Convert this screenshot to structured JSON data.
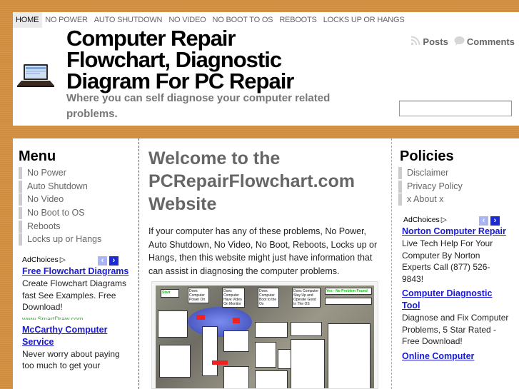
{
  "nav": {
    "items": [
      "HOME",
      "NO POWER",
      "AUTO SHUTDOWN",
      "NO VIDEO",
      "NO BOOT TO OS",
      "REBOOTS",
      "LOCKS UP OR HANGS"
    ],
    "active": "HOME"
  },
  "header": {
    "title": "Computer Repair Flowchart, Diagnostic Diagram For PC Repair",
    "tagline": "Where you can self diagnose your computer related problems.",
    "feeds": {
      "posts": "Posts",
      "comments": "Comments"
    },
    "logo_icon": "laptop-icon",
    "search_value": ""
  },
  "left": {
    "menu_title": "Menu",
    "menu_items": [
      "No Power",
      "Auto Shutdown",
      "No Video",
      "No Boot to OS",
      "Reboots",
      "Locks up or Hangs"
    ],
    "ad": {
      "adchoices": "AdChoices",
      "items": [
        {
          "title": "Free Flowchart Diagrams",
          "desc": "Create Flowchart Diagrams fast See Examples. Free Download!",
          "url": "www.SmartDraw.com"
        },
        {
          "title": "McCarthy Computer Service",
          "desc": "Never worry about paying too much to get your"
        }
      ]
    }
  },
  "main": {
    "heading": "Welcome to the PCRepairFlowchart.com Website",
    "intro": "If your computer has any of these problems, No Power, Auto Shutdown, No Video, No Boot, Reboots, Locks up or Hangs, then this website might just have information that can assist in diagnosing the computer problems.",
    "flowchart": {
      "start": "Start",
      "q1": "Does Computer Power On",
      "q2": "Does Computer Have Video On Monitor",
      "q3": "Does Computer Boot to the Os",
      "q4": "Does Computer Stay Up and Operate Good In The OS",
      "yes": "Yes",
      "no": "NO",
      "done": "Yes - No Problem Found"
    }
  },
  "right": {
    "policies_title": "Policies",
    "policies": [
      "Disclaimer",
      "Privacy Policy",
      "x About x"
    ],
    "ad": {
      "adchoices": "AdChoices",
      "items": [
        {
          "title": "Norton Computer Repair",
          "desc": "Live Tech Help For Your Computer By Norton Experts Call (877) 526-9843!"
        },
        {
          "title": "Computer Diagnostic Tool",
          "desc": "Diagnose and Fix Computer Problems, 5 Star Rated - Free Download!"
        },
        {
          "title": "Online Computer"
        }
      ]
    }
  },
  "colors": {
    "background": "#d48f3f",
    "link": "#1a1ad2",
    "menu_marker": "#cccccc",
    "heading_gray": "#666666"
  }
}
